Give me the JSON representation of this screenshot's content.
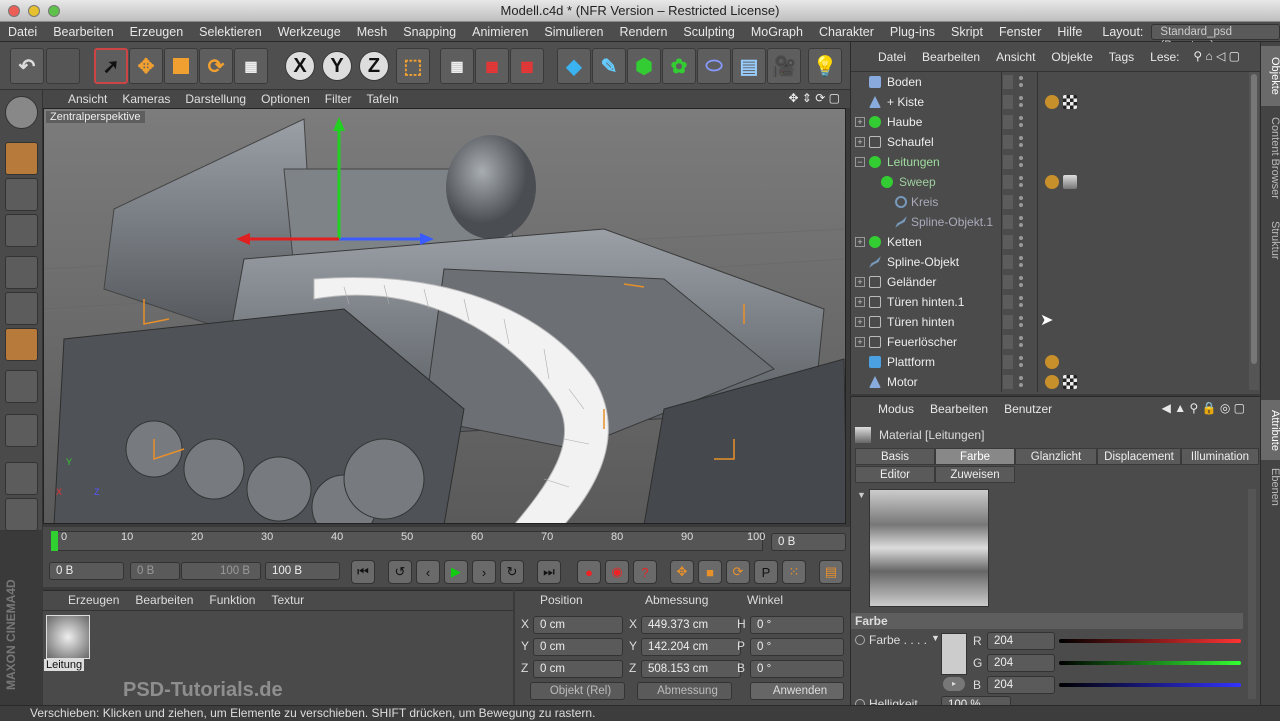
{
  "window": {
    "title": "Modell.c4d * (NFR Version – Restricted License)"
  },
  "menubar": {
    "items": [
      "Datei",
      "Bearbeiten",
      "Erzeugen",
      "Selektieren",
      "Werkzeuge",
      "Mesh",
      "Snapping",
      "Animieren",
      "Simulieren",
      "Rendern",
      "Sculpting",
      "MoGraph",
      "Charakter",
      "Plug-ins",
      "Skript",
      "Fenster",
      "Hilfe"
    ],
    "layout_label": "Layout:",
    "layout_value": "Standard_psd (Benutzer)"
  },
  "viewport": {
    "menu": [
      "Ansicht",
      "Kameras",
      "Darstellung",
      "Optionen",
      "Filter",
      "Tafeln"
    ],
    "label": "Zentralperspektive",
    "axis": {
      "x": "X",
      "y": "Y",
      "z": "Z"
    }
  },
  "timeline": {
    "ticks": [
      "0",
      "10",
      "20",
      "30",
      "40",
      "50",
      "60",
      "70",
      "80",
      "90",
      "100"
    ],
    "current": "0 B"
  },
  "transport": {
    "start": "0 B",
    "preview_start": "0 B",
    "preview_end": "100 B",
    "end": "100 B"
  },
  "material_panel": {
    "menu": [
      "Erzeugen",
      "Bearbeiten",
      "Funktion",
      "Textur"
    ],
    "material_name": "Leitung"
  },
  "coords": {
    "headers": [
      "Position",
      "Abmessung",
      "Winkel"
    ],
    "rows": [
      {
        "axis": "X",
        "pos": "0 cm",
        "size_axis": "X",
        "size": "449.373 cm",
        "rot_axis": "H",
        "rot": "0 °"
      },
      {
        "axis": "Y",
        "pos": "0 cm",
        "size_axis": "Y",
        "size": "142.204 cm",
        "rot_axis": "P",
        "rot": "0 °"
      },
      {
        "axis": "Z",
        "pos": "0 cm",
        "size_axis": "Z",
        "size": "508.153 cm",
        "rot_axis": "B",
        "rot": "0 °"
      }
    ],
    "mode": "Objekt (Rel)",
    "size_mode": "Abmessung",
    "apply": "Anwenden"
  },
  "status": "Verschieben: Klicken und ziehen, um Elemente zu verschieben. SHIFT drücken, um Bewegung zu rastern.",
  "watermark": "PSD-Tutorials.de",
  "objects_panel": {
    "menu": [
      "Datei",
      "Bearbeiten",
      "Ansicht",
      "Objekte",
      "Tags",
      "Lese:"
    ],
    "rows": [
      {
        "name": "Boden"
      },
      {
        "name": "+ Kiste"
      },
      {
        "name": "Haube"
      },
      {
        "name": "Schaufel"
      },
      {
        "name": "Leitungen"
      },
      {
        "name": "Sweep"
      },
      {
        "name": "Kreis"
      },
      {
        "name": "Spline-Objekt.1"
      },
      {
        "name": "Ketten"
      },
      {
        "name": "Spline-Objekt"
      },
      {
        "name": "Geländer"
      },
      {
        "name": "Türen hinten.1"
      },
      {
        "name": "Türen hinten"
      },
      {
        "name": "Feuerlöscher"
      },
      {
        "name": "Plattform"
      },
      {
        "name": "Motor"
      }
    ]
  },
  "side_tabs": [
    "Objekte",
    "Content Browser",
    "Struktur",
    "Attribute",
    "Ebenen"
  ],
  "attributes": {
    "menu": [
      "Modus",
      "Bearbeiten",
      "Benutzer"
    ],
    "title": "Material [Leitungen]",
    "tabs": [
      "Basis",
      "Farbe",
      "Glanzlicht",
      "Displacement",
      "Illumination",
      "Editor",
      "Zuweisen"
    ],
    "section": "Farbe",
    "color_label": "Farbe . . . .",
    "r_label": "R",
    "g_label": "G",
    "b_label": "B",
    "r": "204",
    "g": "204",
    "b": "204",
    "brightness_label": "Helligkeit . . .",
    "brightness": "100 %"
  }
}
